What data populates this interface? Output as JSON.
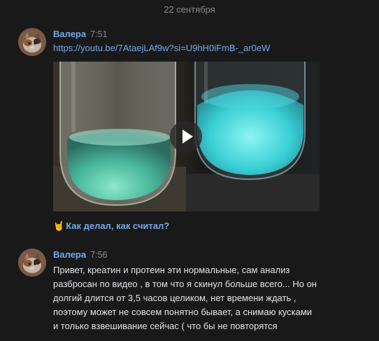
{
  "date_separator": "22 сентября",
  "messages": [
    {
      "author": "Валера",
      "time": "7:51",
      "link": "https://youtu.be/7AtaejLAf9w?si=U9hH0iFmB-_ar0eW",
      "video_link_title": "Как делал, как считал?",
      "video_link_emoji": "🤘",
      "icons": {
        "avatar": "cat-avatar",
        "play": "play-icon"
      }
    },
    {
      "author": "Валера",
      "time": "7:56",
      "lines": [
        "Привет, креатин и протеин эти нормальные, сам анализ",
        "разбросан по видео , в том что я скинул больше всего... Но он",
        "долгий длится от 3,5 часов целиком, нет времени ждать ,",
        "поэтому может не совсем понятно бывает, а снимаю кусками",
        "и только взвешивание сейчас ( что бы не повторятся"
      ]
    }
  ],
  "colors": {
    "background": "#19191a",
    "accent_link": "#71aaeb",
    "text_primary": "#e1e3e6",
    "text_secondary": "#8a8c90"
  }
}
